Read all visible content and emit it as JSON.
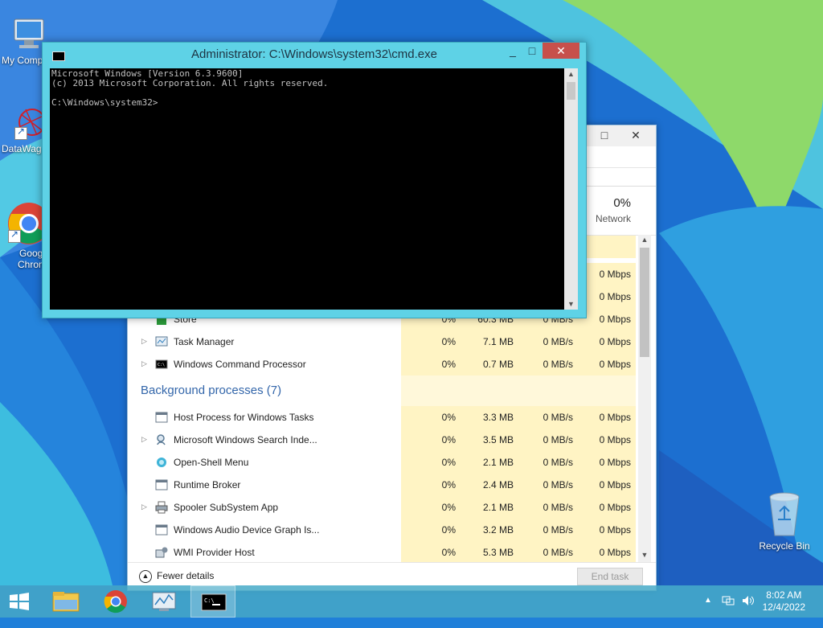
{
  "desktop": {
    "icons": [
      {
        "label": "My Comp",
        "icon": "computer-icon"
      },
      {
        "label": "DataWag",
        "icon": "datawag-icon"
      },
      {
        "label": "Googl\nChrom",
        "label_line1": "Googl",
        "label_line2": "Chrom",
        "icon": "chrome-icon"
      },
      {
        "label": "Recycle Bin",
        "icon": "recycle-bin-icon"
      }
    ]
  },
  "cmd": {
    "title": "Administrator: C:\\Windows\\system32\\cmd.exe",
    "console_lines": [
      "Microsoft Windows [Version 6.3.9600]",
      "(c) 2013 Microsoft Corporation. All rights reserved.",
      "",
      "C:\\Windows\\system32>"
    ],
    "minimize": "_",
    "maximize": "□",
    "close": "✕"
  },
  "taskmgr": {
    "maximize": "□",
    "close": "✕",
    "network_pct": "0%",
    "network_label": "Network",
    "apps": [
      {
        "name": "Store",
        "cpu": "0%",
        "mem": "60.3 MB",
        "disk": "0 MB/s",
        "net": "0 Mbps",
        "expandable": false
      },
      {
        "name": "Task Manager",
        "cpu": "0%",
        "mem": "7.1 MB",
        "disk": "0 MB/s",
        "net": "0 Mbps",
        "expandable": true
      },
      {
        "name": "Windows Command Processor",
        "cpu": "0%",
        "mem": "0.7 MB",
        "disk": "0 MB/s",
        "net": "0 Mbps",
        "expandable": true
      }
    ],
    "hidden_net": [
      "0 Mbps",
      "0 Mbps"
    ],
    "background_title": "Background processes (7)",
    "background": [
      {
        "name": "Host Process for Windows Tasks",
        "cpu": "0%",
        "mem": "3.3 MB",
        "disk": "0 MB/s",
        "net": "0 Mbps",
        "expandable": false
      },
      {
        "name": "Microsoft Windows Search Inde...",
        "cpu": "0%",
        "mem": "3.5 MB",
        "disk": "0 MB/s",
        "net": "0 Mbps",
        "expandable": true
      },
      {
        "name": "Open-Shell Menu",
        "cpu": "0%",
        "mem": "2.1 MB",
        "disk": "0 MB/s",
        "net": "0 Mbps",
        "expandable": false
      },
      {
        "name": "Runtime Broker",
        "cpu": "0%",
        "mem": "2.4 MB",
        "disk": "0 MB/s",
        "net": "0 Mbps",
        "expandable": false
      },
      {
        "name": "Spooler SubSystem App",
        "cpu": "0%",
        "mem": "2.1 MB",
        "disk": "0 MB/s",
        "net": "0 Mbps",
        "expandable": true
      },
      {
        "name": "Windows Audio Device Graph Is...",
        "cpu": "0%",
        "mem": "3.2 MB",
        "disk": "0 MB/s",
        "net": "0 Mbps",
        "expandable": false
      },
      {
        "name": "WMI Provider Host",
        "cpu": "0%",
        "mem": "5.3 MB",
        "disk": "0 MB/s",
        "net": "0 Mbps",
        "expandable": false
      }
    ],
    "fewer_details": "Fewer details",
    "end_task": "End task"
  },
  "taskbar": {
    "items": [
      "start-button",
      "file-explorer",
      "chrome",
      "task-manager",
      "command-prompt"
    ],
    "active_item": "command-prompt",
    "clock_time": "8:02 AM",
    "clock_date": "12/4/2022"
  },
  "colors": {
    "cmd_frame": "#5ed2e6",
    "close_red": "#c7504b",
    "heat_yellow": "#fff4c4",
    "group_blue": "#3366aa"
  }
}
